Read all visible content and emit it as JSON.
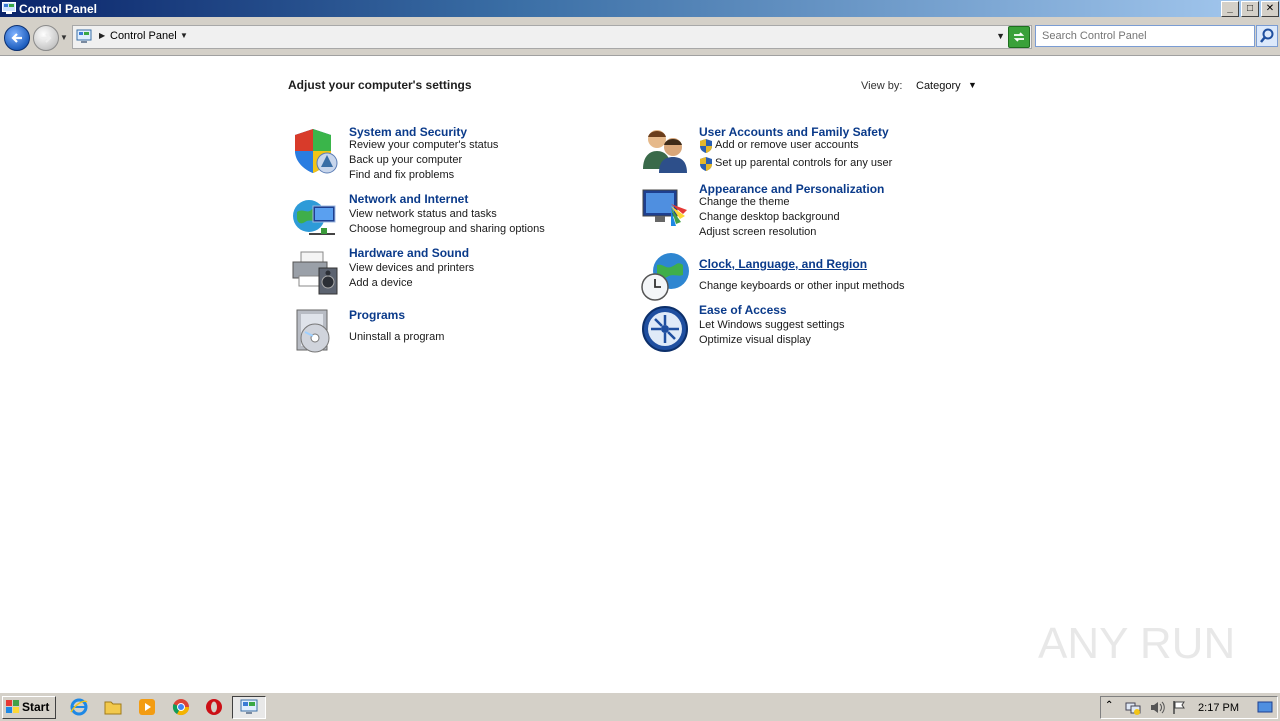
{
  "window": {
    "title": "Control Panel",
    "controls": {
      "minimize": "_",
      "maximize": "□",
      "close": "✕"
    }
  },
  "address": {
    "breadcrumb": "Control Panel",
    "search_placeholder": "Search Control Panel"
  },
  "content": {
    "heading": "Adjust your computer's settings",
    "view_by_label": "View by:",
    "view_by_value": "Category"
  },
  "categories": [
    {
      "title": "System and Security",
      "icon": "security-shield-icon",
      "links": [
        "Review your computer's status",
        "Back up your computer",
        "Find and fix problems"
      ]
    },
    {
      "title": "Network and Internet",
      "icon": "network-globe-icon",
      "links": [
        "View network status and tasks",
        "Choose homegroup and sharing options"
      ]
    },
    {
      "title": "Hardware and Sound",
      "icon": "printer-speaker-icon",
      "links": [
        "View devices and printers",
        "Add a device"
      ]
    },
    {
      "title": "Programs",
      "icon": "programs-disc-icon",
      "links": [
        "Uninstall a program"
      ]
    },
    {
      "title": "User Accounts and Family Safety",
      "icon": "users-icon",
      "links": [
        "Add or remove user accounts",
        "Set up parental controls for any user"
      ]
    },
    {
      "title": "Appearance and Personalization",
      "icon": "monitor-palette-icon",
      "links": [
        "Change the theme",
        "Change desktop background",
        "Adjust screen resolution"
      ]
    },
    {
      "title": "Clock, Language, and Region",
      "icon": "globe-clock-icon",
      "links": [
        "Change keyboards or other input methods"
      ]
    },
    {
      "title": "Ease of Access",
      "icon": "ease-of-access-icon",
      "links": [
        "Let Windows suggest settings",
        "Optimize visual display"
      ]
    }
  ],
  "watermark": {
    "text": "ANY RUN"
  },
  "taskbar": {
    "start_label": "Start",
    "quick_launch": [
      "internet-explorer-icon",
      "folder-icon",
      "media-player-icon",
      "chrome-icon",
      "opera-icon"
    ],
    "active_task_icon": "control-panel-icon",
    "clock": "2:17 PM"
  }
}
